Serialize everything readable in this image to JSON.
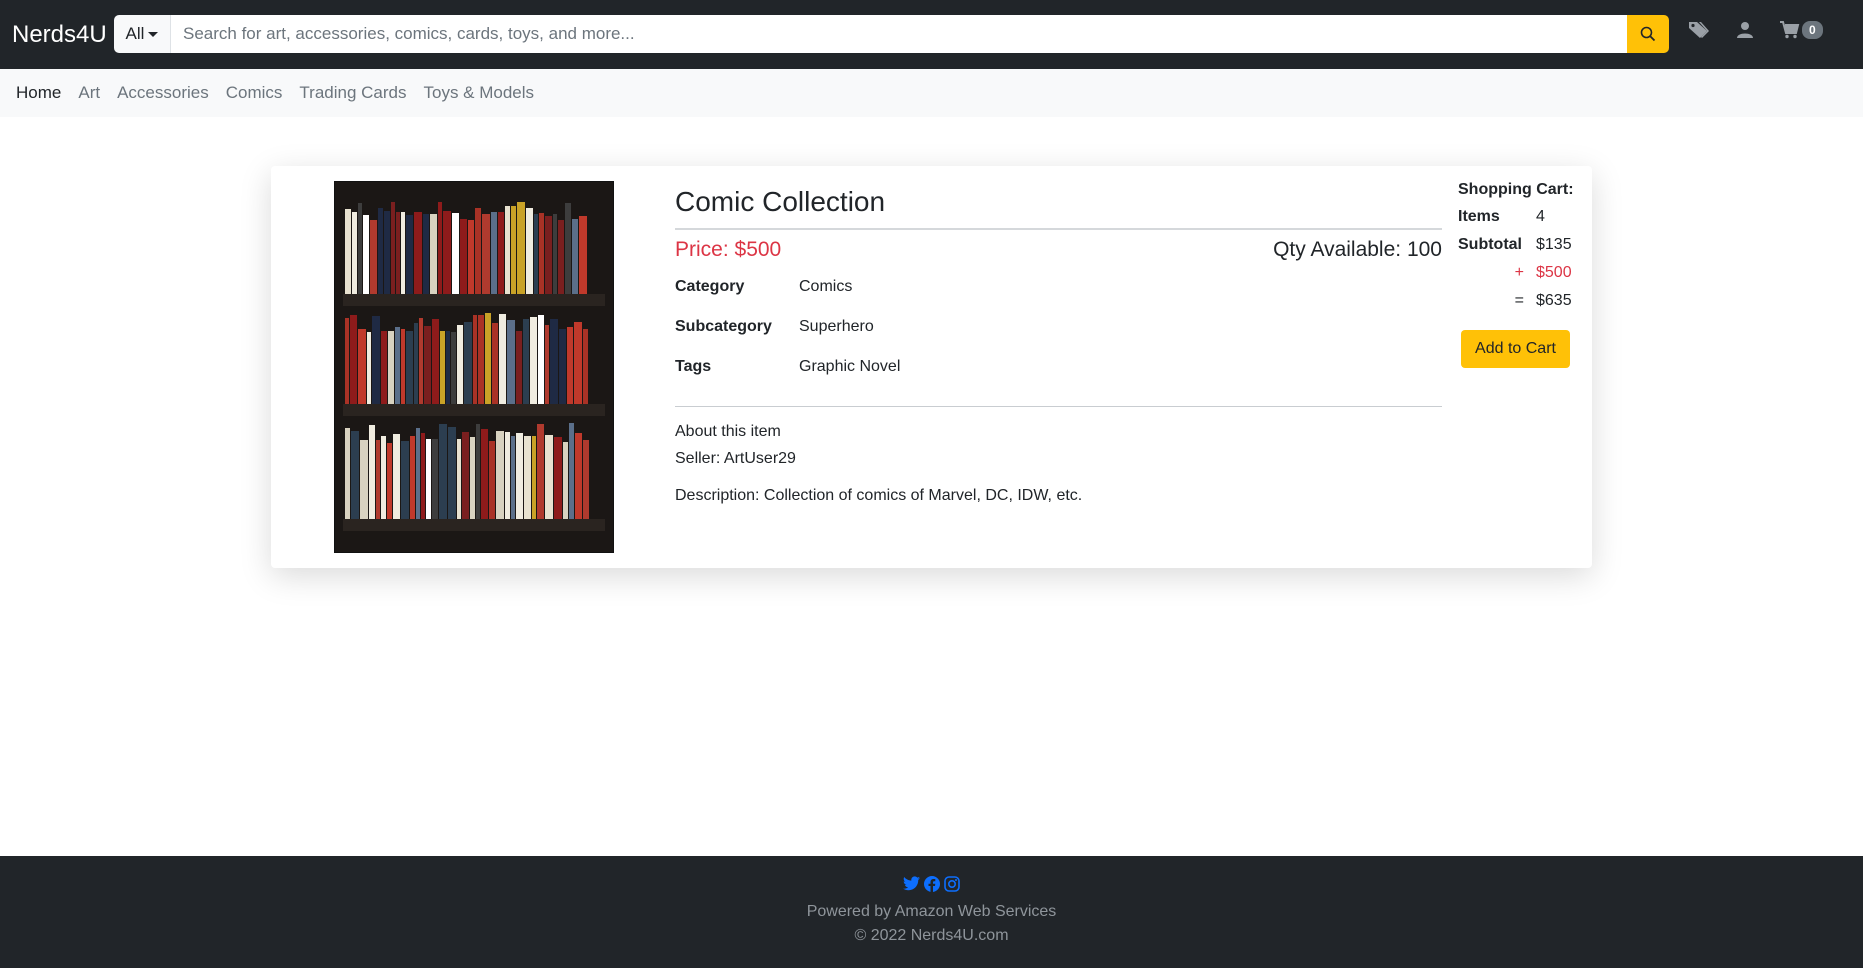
{
  "brand": "Nerds4U",
  "search": {
    "category": "All",
    "placeholder": "Search for art, accessories, comics, cards, toys, and more..."
  },
  "header_icons": [
    "search-icon",
    "tags-icon",
    "user-icon",
    "cart-icon"
  ],
  "cart_badge": "0",
  "categories": [
    "Home",
    "Art",
    "Accessories",
    "Comics",
    "Trading Cards",
    "Toys & Models"
  ],
  "product": {
    "title": "Comic Collection",
    "price": "Price: $500",
    "qty": "Qty Available: 100",
    "attributes": [
      {
        "key": "Category",
        "value": "Comics"
      },
      {
        "key": "Subcategory",
        "value": "Superhero"
      },
      {
        "key": "Tags",
        "value": "Graphic Novel"
      }
    ],
    "about_heading": "About this item",
    "seller": "Seller: ArtUser29",
    "description": "Description: Collection of comics of Marvel, DC, IDW, etc."
  },
  "cart": {
    "title": "Shopping Cart:",
    "items_label": "Items",
    "items_value": "4",
    "subtotal_label": "Subtotal",
    "subtotal_value": "$135",
    "plus_op": "+",
    "plus_value": "$500",
    "equals_op": "=",
    "total_value": "$635",
    "add_button": "Add to Cart"
  },
  "footer": {
    "line1": "Powered by Amazon Web Services",
    "line2": "© 2022 Nerds4U.com"
  },
  "colors": {
    "navbar_bg": "#212529",
    "accent_yellow": "#ffc107",
    "price_red": "#dc3545",
    "social_blue": "#0d6efd"
  }
}
